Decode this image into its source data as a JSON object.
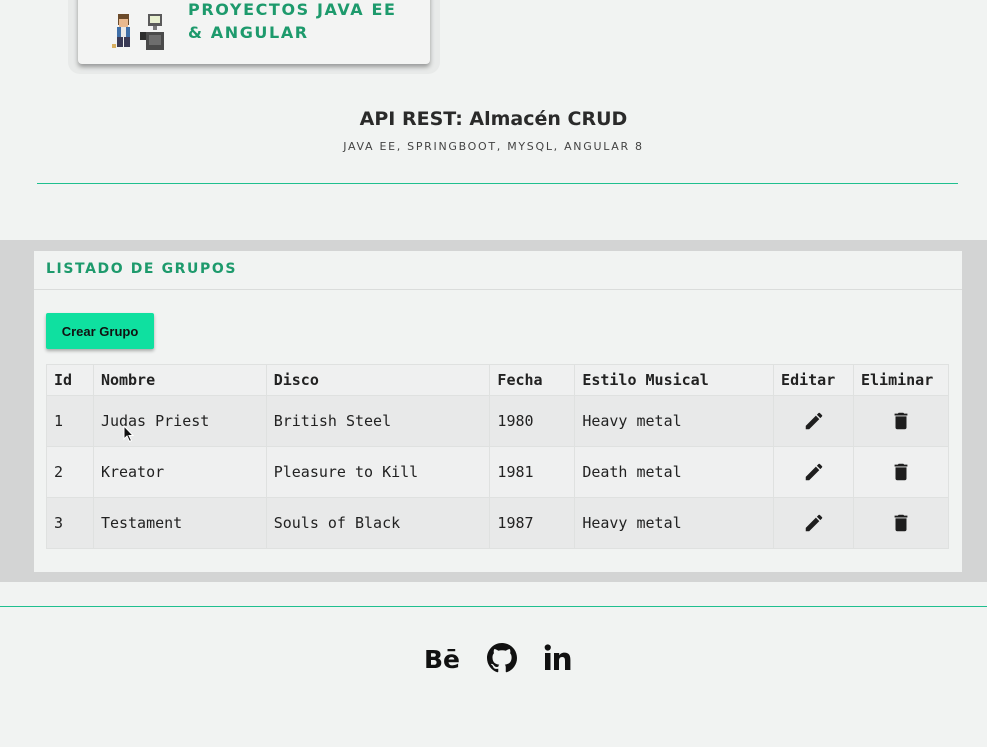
{
  "hero": {
    "title": "PROYECTOS JAVA EE & ANGULAR",
    "illustration": "developer-with-computer-illustration"
  },
  "header": {
    "title": "API REST: Almacén CRUD",
    "subtitle": "JAVA EE, SPRINGBOOT, MYSQL, ANGULAR 8"
  },
  "panel": {
    "title": "LISTADO DE GRUPOS",
    "create_button": "Crear Grupo"
  },
  "table": {
    "columns": [
      "Id",
      "Nombre",
      "Disco",
      "Fecha",
      "Estilo Musical",
      "Editar",
      "Eliminar"
    ],
    "rows": [
      {
        "id": "1",
        "nombre": "Judas Priest",
        "disco": "British Steel",
        "fecha": "1980",
        "estilo": "Heavy metal"
      },
      {
        "id": "2",
        "nombre": "Kreator",
        "disco": "Pleasure to Kill",
        "fecha": "1981",
        "estilo": "Death metal"
      },
      {
        "id": "3",
        "nombre": "Testament",
        "disco": "Souls of Black",
        "fecha": "1987",
        "estilo": "Heavy metal"
      }
    ],
    "edit_icon": "pencil-icon",
    "delete_icon": "trash-icon"
  },
  "footer": {
    "social_icons": [
      "behance-icon",
      "github-icon",
      "linkedin-icon"
    ]
  },
  "colors": {
    "accent": "#1d9a6c",
    "button": "#0fe0a0",
    "divider": "#1fbf8f",
    "band": "#d3d4d4",
    "background": "#f1f3f2"
  }
}
